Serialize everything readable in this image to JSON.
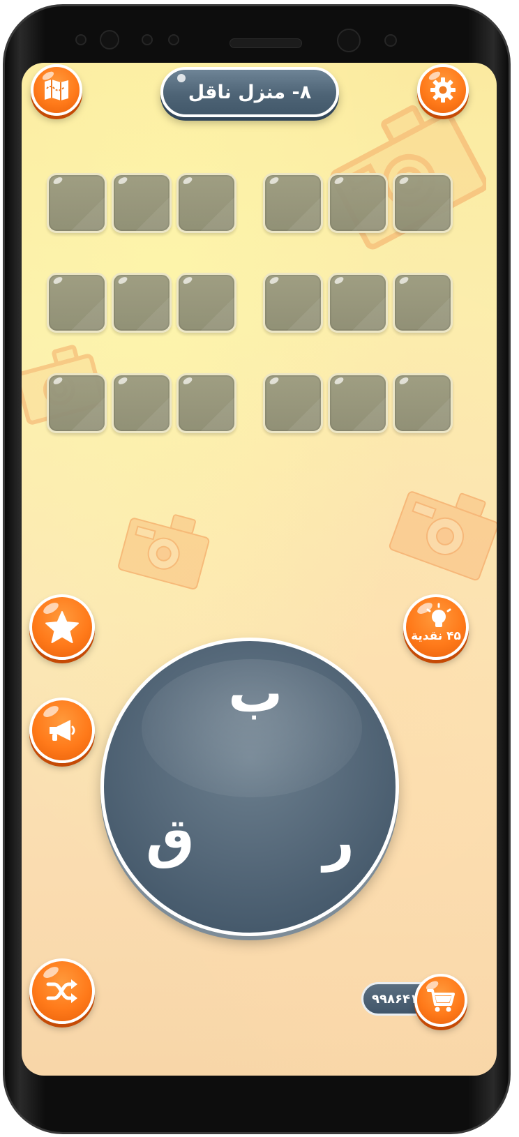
{
  "level": {
    "title": "٨- منزل ناقل"
  },
  "board": {
    "rows": 3,
    "columns": 6
  },
  "wheel": {
    "letters": [
      "ب",
      "ر",
      "ق"
    ]
  },
  "hint": {
    "cost_label": "۴۵ نقدیة"
  },
  "coins": {
    "balance": "۹۹۸۶۴۱"
  },
  "icons": {
    "map": "map-icon",
    "settings": "gear-icon",
    "favorite": "star-icon",
    "share": "megaphone-icon",
    "hint": "lightbulb-icon",
    "shuffle": "shuffle-icon",
    "shop": "cart-icon"
  },
  "colors": {
    "button_orange": "#ff7a1a",
    "pill_slate": "#4e6476",
    "tile_gray": "#8c8c74",
    "background_yellow": "#fbf0ad"
  }
}
